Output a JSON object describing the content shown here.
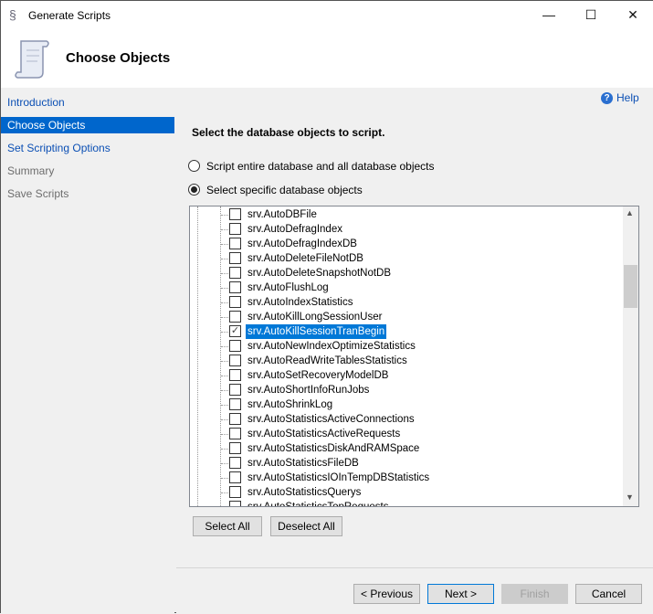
{
  "window": {
    "title": "Generate Scripts",
    "minimize": "—",
    "maximize": "☐",
    "close": "✕"
  },
  "header": {
    "title": "Choose Objects"
  },
  "nav": {
    "items": [
      {
        "label": "Introduction",
        "state": "link"
      },
      {
        "label": "Choose Objects",
        "state": "selected"
      },
      {
        "label": "Set Scripting Options",
        "state": "link"
      },
      {
        "label": "Summary",
        "state": "disabled"
      },
      {
        "label": "Save Scripts",
        "state": "disabled"
      }
    ]
  },
  "main": {
    "help": "Help",
    "instruction": "Select the database objects to script.",
    "option_entire": "Script entire database and all database objects",
    "option_specific": "Select specific database objects",
    "selected_option": "specific",
    "objects": [
      {
        "name": "srv.AutoDBFile",
        "checked": false
      },
      {
        "name": "srv.AutoDefragIndex",
        "checked": false
      },
      {
        "name": "srv.AutoDefragIndexDB",
        "checked": false
      },
      {
        "name": "srv.AutoDeleteFileNotDB",
        "checked": false
      },
      {
        "name": "srv.AutoDeleteSnapshotNotDB",
        "checked": false
      },
      {
        "name": "srv.AutoFlushLog",
        "checked": false
      },
      {
        "name": "srv.AutoIndexStatistics",
        "checked": false
      },
      {
        "name": "srv.AutoKillLongSessionUser",
        "checked": false
      },
      {
        "name": "srv.AutoKillSessionTranBegin",
        "checked": true,
        "selected": true
      },
      {
        "name": "srv.AutoNewIndexOptimizeStatistics",
        "checked": false
      },
      {
        "name": "srv.AutoReadWriteTablesStatistics",
        "checked": false
      },
      {
        "name": "srv.AutoSetRecoveryModelDB",
        "checked": false
      },
      {
        "name": "srv.AutoShortInfoRunJobs",
        "checked": false
      },
      {
        "name": "srv.AutoShrinkLog",
        "checked": false
      },
      {
        "name": "srv.AutoStatisticsActiveConnections",
        "checked": false
      },
      {
        "name": "srv.AutoStatisticsActiveRequests",
        "checked": false
      },
      {
        "name": "srv.AutoStatisticsDiskAndRAMSpace",
        "checked": false
      },
      {
        "name": "srv.AutoStatisticsFileDB",
        "checked": false
      },
      {
        "name": "srv.AutoStatisticsIOInTempDBStatistics",
        "checked": false
      },
      {
        "name": "srv.AutoStatisticsQuerys",
        "checked": false
      },
      {
        "name": "srv.AutoStatisticsTopRequests",
        "checked": false
      }
    ],
    "select_all": "Select All",
    "deselect_all": "Deselect All"
  },
  "footer": {
    "previous": "< Previous",
    "next": "Next >",
    "finish": "Finish",
    "cancel": "Cancel"
  }
}
